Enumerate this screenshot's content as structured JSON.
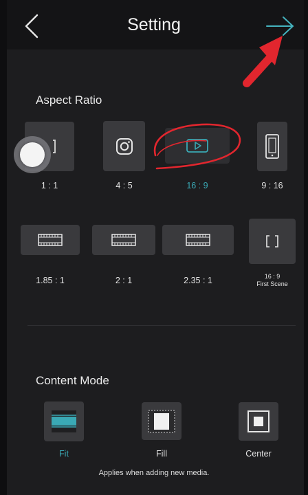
{
  "header": {
    "title": "Setting",
    "back_icon": "chevron-left-icon",
    "next_icon": "arrow-right-icon"
  },
  "aspect_ratio": {
    "heading": "Aspect Ratio",
    "options": [
      {
        "label": "1 : 1",
        "icon": "square-frame-icon"
      },
      {
        "label": "4 : 5",
        "icon": "instagram-icon"
      },
      {
        "label": "16 : 9",
        "icon": "youtube-play-icon",
        "selected": true
      },
      {
        "label": "9 : 16",
        "icon": "phone-icon"
      },
      {
        "label": "1.85 : 1",
        "icon": "film-strip-icon"
      },
      {
        "label": "2 : 1",
        "icon": "film-strip-icon"
      },
      {
        "label": "2.35 : 1",
        "icon": "film-strip-icon"
      },
      {
        "label_line1": "16 : 9",
        "label_line2": "First Scene",
        "icon": "brackets-icon"
      }
    ]
  },
  "content_mode": {
    "heading": "Content Mode",
    "options": [
      {
        "label": "Fit",
        "icon": "fit-icon",
        "selected": true
      },
      {
        "label": "Fill",
        "icon": "fill-icon"
      },
      {
        "label": "Center",
        "icon": "center-icon"
      }
    ],
    "note": "Applies when adding new media."
  },
  "colors": {
    "accent": "#3aa9b5",
    "annotation": "#e2262e",
    "background": "#1d1d1f",
    "tile": "#3a3a3d"
  }
}
